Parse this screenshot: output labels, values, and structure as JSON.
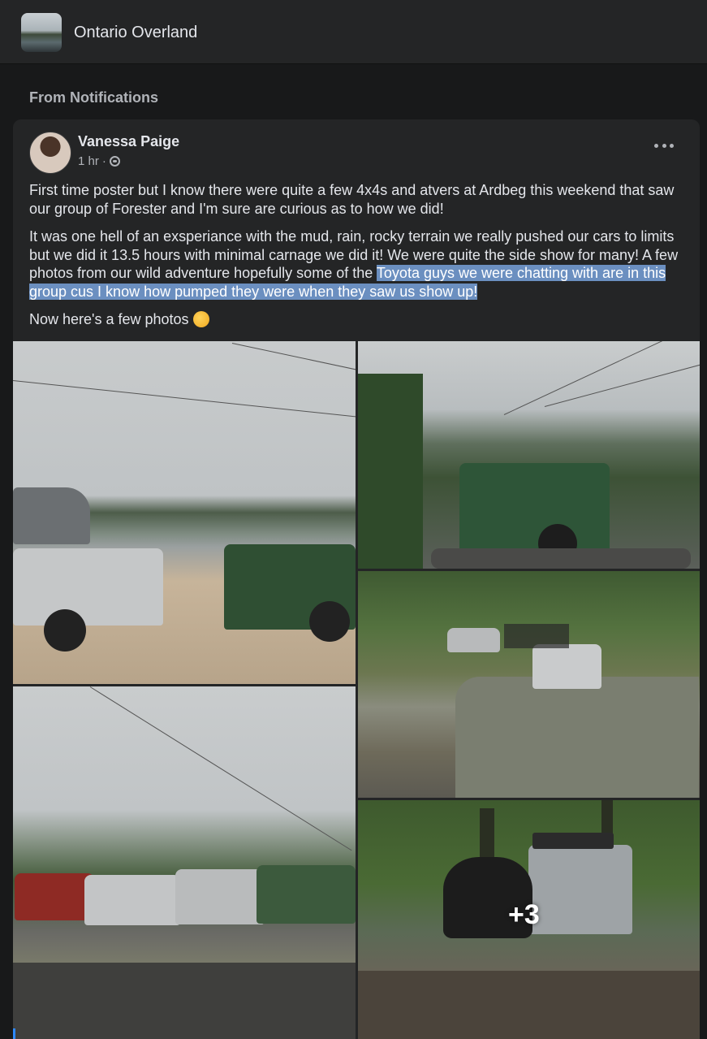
{
  "header": {
    "group_name": "Ontario Overland",
    "thumbnail_icon": "group-thumbnail"
  },
  "section": {
    "label": "From Notifications"
  },
  "post": {
    "author": "Vanessa Paige",
    "time": "1 hr",
    "separator": "·",
    "privacy_icon": "globe-icon",
    "more_icon": "more-options-icon",
    "paragraphs": {
      "p1": "First time poster but I know there were quite a few 4x4s and atvers at Ardbeg this weekend that saw our group of Forester and I'm sure are curious as to how we did!",
      "p2_plain": "It was one hell of an exsperiance with the mud, rain, rocky terrain we really pushed our cars to limits but we did it 13.5 hours with minimal carnage we did it! We were quite the side show for many! A few photos from our wild adventure hopefully some of the ",
      "p2_highlight": "Toyota guys we were chatting with are in this group cus I know how pumped they were when they saw us show up!",
      "p3": "Now here's a few photos"
    },
    "emoji": "face-emoji",
    "more_photos": "+3"
  },
  "colors": {
    "background": "#18191a",
    "card": "#242526",
    "text": "#e4e6eb",
    "secondary_text": "#b0b3b8",
    "highlight": "#6b8fc0"
  }
}
